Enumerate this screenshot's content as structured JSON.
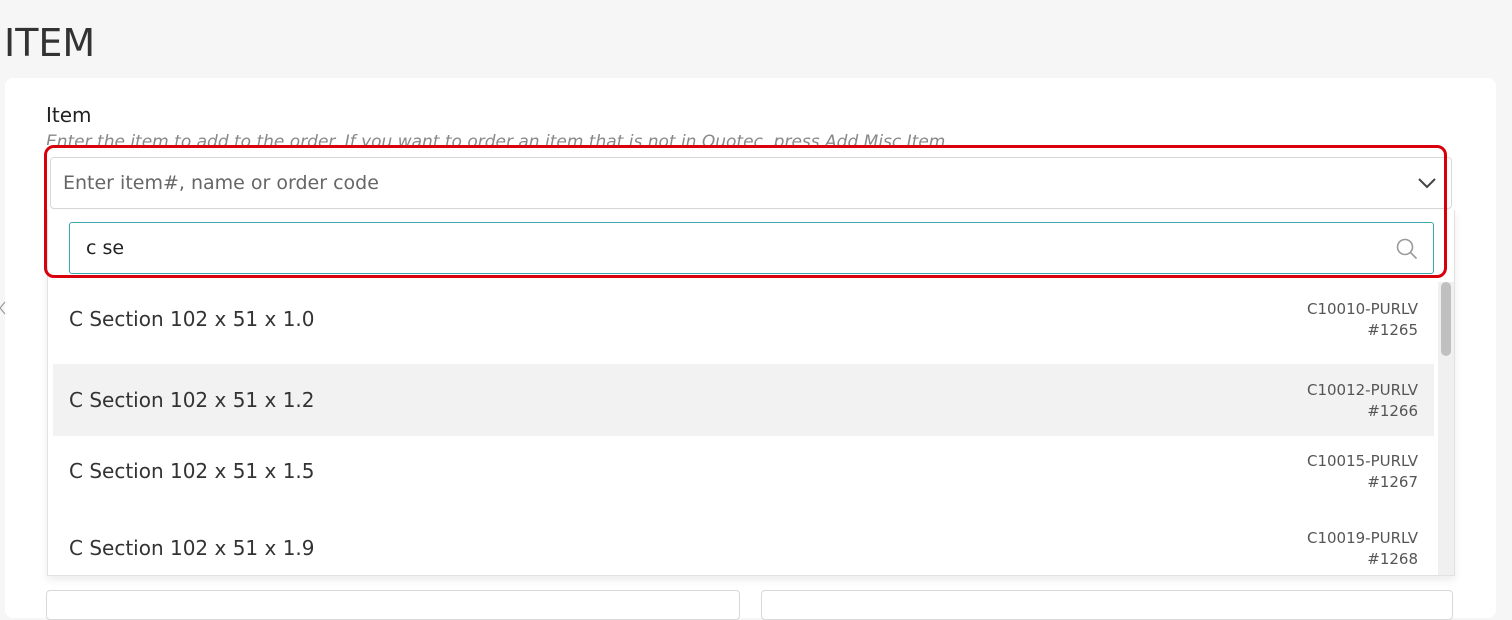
{
  "page": {
    "title": "ITEM"
  },
  "item_field": {
    "label": "Item",
    "hint": "Enter the item to add to the order. If you want to order an item that is not in Quotec, press Add Misc Item.",
    "placeholder": "Enter item#, name or order code",
    "chevron_icon": "chevron-down-icon"
  },
  "dropdown": {
    "search_value": "c se",
    "search_icon": "search-icon",
    "options": [
      {
        "name": "C Section 102 x 51 x 1.0",
        "code": "C10010-PURLV",
        "id": "#1265",
        "highlighted": false
      },
      {
        "name": "C Section 102 x 51 x 1.2",
        "code": "C10012-PURLV",
        "id": "#1266",
        "highlighted": true
      },
      {
        "name": "C Section 102 x 51 x 1.5",
        "code": "C10015-PURLV",
        "id": "#1267",
        "highlighted": false
      },
      {
        "name": "C Section 102 x 51 x 1.9",
        "code": "C10019-PURLV",
        "id": "#1268",
        "highlighted": false
      }
    ]
  },
  "colors": {
    "highlight_frame": "#d9000d",
    "search_border": "#3aa6b0",
    "highlighted_row": "#f2f2f2"
  }
}
